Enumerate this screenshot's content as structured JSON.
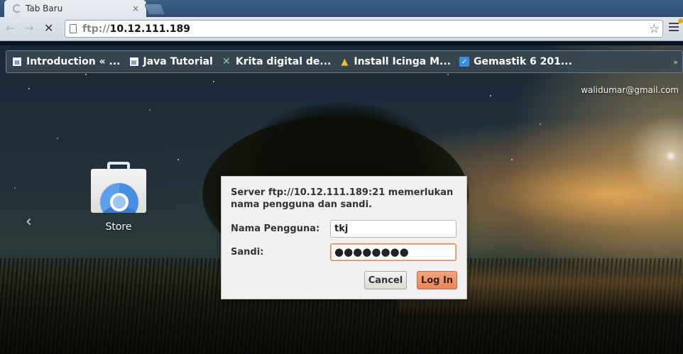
{
  "tab": {
    "title": "Tab Baru",
    "close": "×"
  },
  "toolbar": {
    "back": "←",
    "forward": "→",
    "stop": "✕",
    "url_scheme": "ftp://",
    "url_host": "10.12.111.189",
    "star": "☆"
  },
  "bookmarks": {
    "items": [
      {
        "label": "Introduction « ...",
        "icon": "page-icon"
      },
      {
        "label": "Java Tutorial",
        "icon": "page-icon"
      },
      {
        "label": "Krita digital de...",
        "icon": "krita-icon"
      },
      {
        "label": "Install Icinga M...",
        "icon": "icinga-icon"
      },
      {
        "label": "Gemastik 6 201...",
        "icon": "checkbox-icon"
      }
    ],
    "more": "»"
  },
  "ntp": {
    "account": "walidumar@gmail.com",
    "prev_arrow": "‹",
    "apps": [
      {
        "label": "Store"
      }
    ]
  },
  "dialog": {
    "message": "Server ftp://10.12.111.189:21 memerlukan nama pengguna dan sandi.",
    "username_label": "Nama Pengguna:",
    "username_value": "tkj",
    "password_label": "Sandi:",
    "password_value": "●●●●●●●●",
    "cancel_label": "Cancel",
    "login_label": "Log In"
  },
  "colors": {
    "login_button": "#e8865c",
    "tabstrip": "#2f4f74",
    "focus_border": "#e08a5a"
  }
}
